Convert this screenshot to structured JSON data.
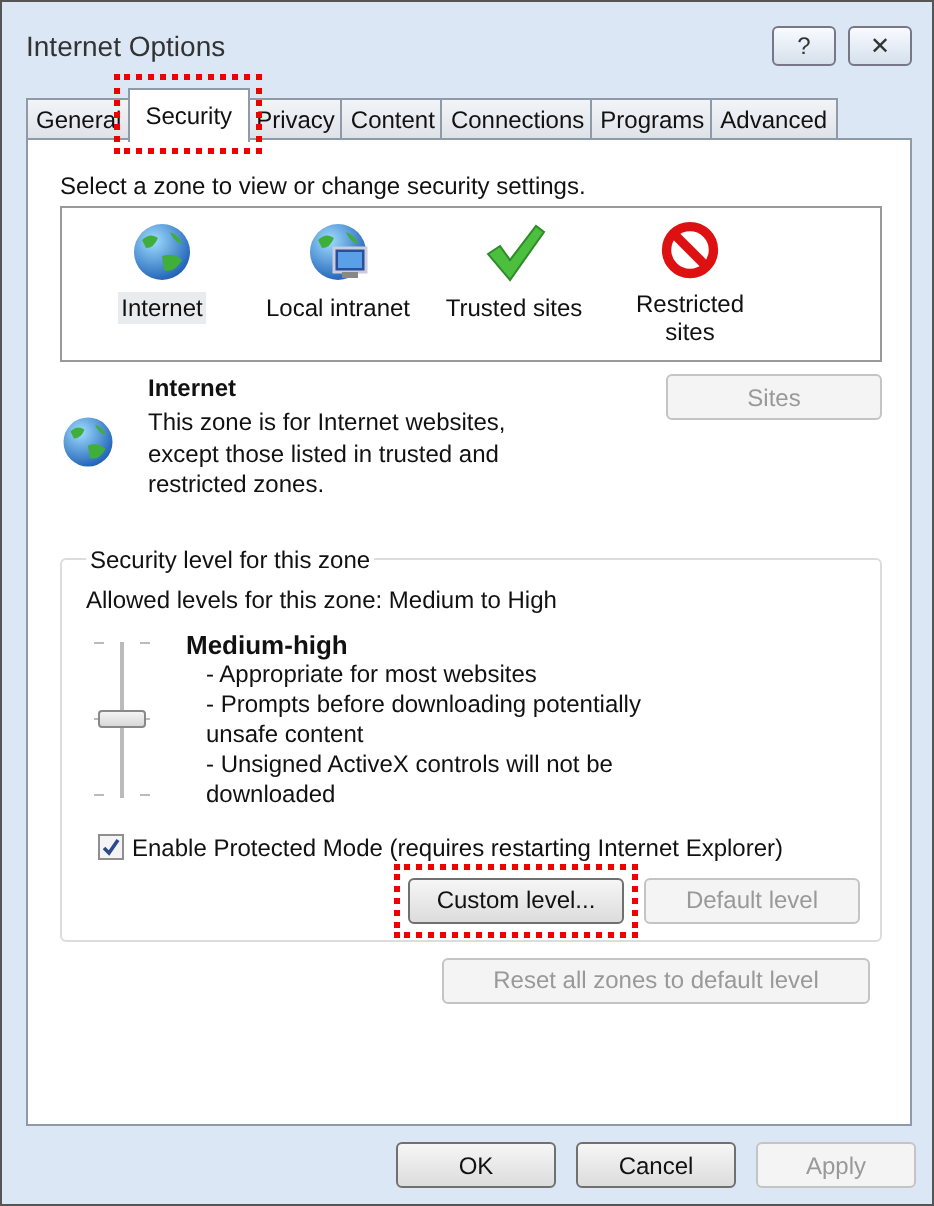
{
  "window": {
    "title": "Internet Options"
  },
  "title_buttons": [
    {
      "label": "?"
    },
    {
      "label": "✕"
    }
  ],
  "tabs": [
    {
      "label": "General",
      "selected": false,
      "highlighted": false
    },
    {
      "label": "Security",
      "selected": true,
      "highlighted": true
    },
    {
      "label": "Privacy",
      "selected": false,
      "highlighted": false
    },
    {
      "label": "Content",
      "selected": false,
      "highlighted": false
    },
    {
      "label": "Connections",
      "selected": false,
      "highlighted": false
    },
    {
      "label": "Programs",
      "selected": false,
      "highlighted": false
    },
    {
      "label": "Advanced",
      "selected": false,
      "highlighted": false
    }
  ],
  "zone_prompt": "Select a zone to view or change security settings.",
  "zones": [
    {
      "kind": "internet",
      "label": "Internet",
      "selected": true
    },
    {
      "kind": "intranet",
      "label": "Local intranet",
      "selected": false
    },
    {
      "kind": "trusted",
      "label": "Trusted sites",
      "selected": false
    },
    {
      "kind": "restricted",
      "label": "Restricted sites",
      "selected": false
    }
  ],
  "zone_info": {
    "kind": "internet",
    "title": "Internet",
    "description": "This zone is for Internet websites, except those listed in trusted and restricted zones.",
    "sites_button": {
      "label": "Sites",
      "disabled": true
    }
  },
  "security_level": {
    "legend": "Security level for this zone",
    "allowed": "Allowed levels for this zone: Medium to High",
    "level": 0.5,
    "level_name": "Medium-high",
    "bullets": [
      "- Appropriate for most websites",
      "- Prompts before downloading potentially unsafe content",
      "- Unsigned ActiveX controls will not be downloaded"
    ],
    "protected_mode": {
      "label": "Enable Protected Mode (requires restarting Internet Explorer)",
      "checked": true
    },
    "buttons": [
      {
        "label": "Custom level...",
        "disabled": false,
        "highlighted": true
      },
      {
        "label": "Default level",
        "disabled": true,
        "highlighted": false
      }
    ]
  },
  "reset_button": {
    "label": "Reset all zones to default level",
    "disabled": true
  },
  "footer_buttons": [
    {
      "label": "OK",
      "disabled": false
    },
    {
      "label": "Cancel",
      "disabled": false
    },
    {
      "label": "Apply",
      "disabled": true
    }
  ]
}
